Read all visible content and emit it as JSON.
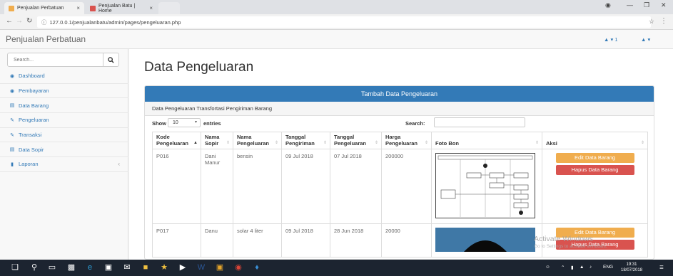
{
  "browser": {
    "tabs": [
      {
        "title": "Penjualan Perbatuan",
        "close": "×"
      },
      {
        "title": "Penjualan Batu | Home",
        "close": "×"
      }
    ],
    "url": "127.0.0.1/penjualanbatu/admin/pages/pengeluaran.php"
  },
  "app": {
    "brand": "Penjualan Perbatuan",
    "alert_count": "1"
  },
  "sidebar": {
    "search_placeholder": "Search...",
    "items": [
      {
        "label": "Dashboard",
        "icon": "dashboard-icon"
      },
      {
        "label": "Pembayaran",
        "icon": "dashboard-icon"
      },
      {
        "label": "Data Barang",
        "icon": "table-icon"
      },
      {
        "label": "Pengeluaran",
        "icon": "edit-icon"
      },
      {
        "label": "Transaksi",
        "icon": "edit-icon"
      },
      {
        "label": "Data Sopir",
        "icon": "table-icon"
      },
      {
        "label": "Laporan",
        "icon": "bar-chart-icon"
      }
    ]
  },
  "main": {
    "title": "Data Pengeluaran",
    "panel_heading": "Tambah Data Pengeluaran",
    "panel_subheading": "Data Pengeluaran Transfortasi Pengiriman Barang",
    "show_label": "Show",
    "page_length": "10",
    "entries_label": "entries",
    "search_label": "Search:",
    "columns": [
      {
        "line1": "Kode",
        "line2": "Pengeluaran"
      },
      {
        "line1": "Nama",
        "line2": "Sopir"
      },
      {
        "line1": "Nama",
        "line2": "Pengeluaran"
      },
      {
        "line1": "Tanggal",
        "line2": "Pengiriman"
      },
      {
        "line1": "Tanggal",
        "line2": "Pengeluaran"
      },
      {
        "line1": "Harga",
        "line2": "Pengeluaran"
      },
      {
        "line1": "",
        "line2": "Foto Bon"
      },
      {
        "line1": "",
        "line2": "Aksi"
      }
    ],
    "rows": [
      {
        "kode": "P016",
        "sopir": "Dani Manur",
        "nama": "bensin",
        "tgl_kirim": "09 Jul 2018",
        "tgl_keluar": "07 Jul 2018",
        "harga": "200000"
      },
      {
        "kode": "P017",
        "sopir": "Danu",
        "nama": "solar 4 liter",
        "tgl_kirim": "09 Jul 2018",
        "tgl_keluar": "28 Jun 2018",
        "harga": "20000"
      }
    ],
    "edit_label": "Edit Data Barang",
    "delete_label": "Hapus Data Barang"
  },
  "windows": {
    "watermark_title": "Activate Windows",
    "watermark_sub": "Go to Settings to activate Windows.",
    "time": "19:31",
    "date": "18/07/2018",
    "language": "ENG"
  }
}
